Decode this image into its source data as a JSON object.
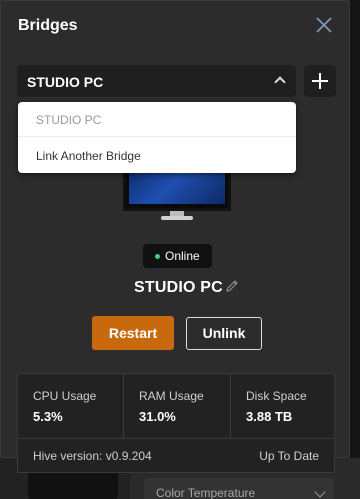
{
  "background": {
    "color_temperature_label": "Color Temperature"
  },
  "panel": {
    "title": "Bridges",
    "selected_bridge": "STUDIO PC",
    "dropdown": {
      "options": [
        "STUDIO PC",
        "Link Another Bridge"
      ]
    },
    "status": "Online",
    "device_name": "STUDIO PC",
    "actions": {
      "restart": "Restart",
      "unlink": "Unlink"
    },
    "stats": [
      {
        "label": "CPU Usage",
        "value": "5.3%"
      },
      {
        "label": "RAM Usage",
        "value": "31.0%"
      },
      {
        "label": "Disk Space",
        "value": "3.88 TB"
      }
    ],
    "version": "Hive version: v0.9.204",
    "update_status": "Up To Date"
  },
  "colors": {
    "accent": "#c8690e",
    "online": "#3ed27a",
    "panel_bg": "#2c2c2c"
  },
  "icons": [
    "close-icon",
    "chevron-up-icon",
    "plus-icon",
    "pencil-icon",
    "monitor-icon",
    "status-dot-icon"
  ]
}
